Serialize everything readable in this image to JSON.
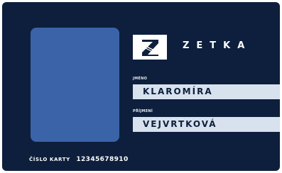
{
  "card": {
    "background_color": "#0d1f3c",
    "photo_color": "#3b63a8",
    "field_color": "#d7e2ee",
    "brand_name": "ZETKA",
    "logo_letter": "Z",
    "name_label": "JMÉNO",
    "name_value": "KLAROMÍRA",
    "surname_label": "PŘÍJMENÍ",
    "surname_value": "VEJVRTKOVÁ",
    "card_number_label": "ČÍSLO KARTY",
    "card_number_value": "12345678910"
  }
}
